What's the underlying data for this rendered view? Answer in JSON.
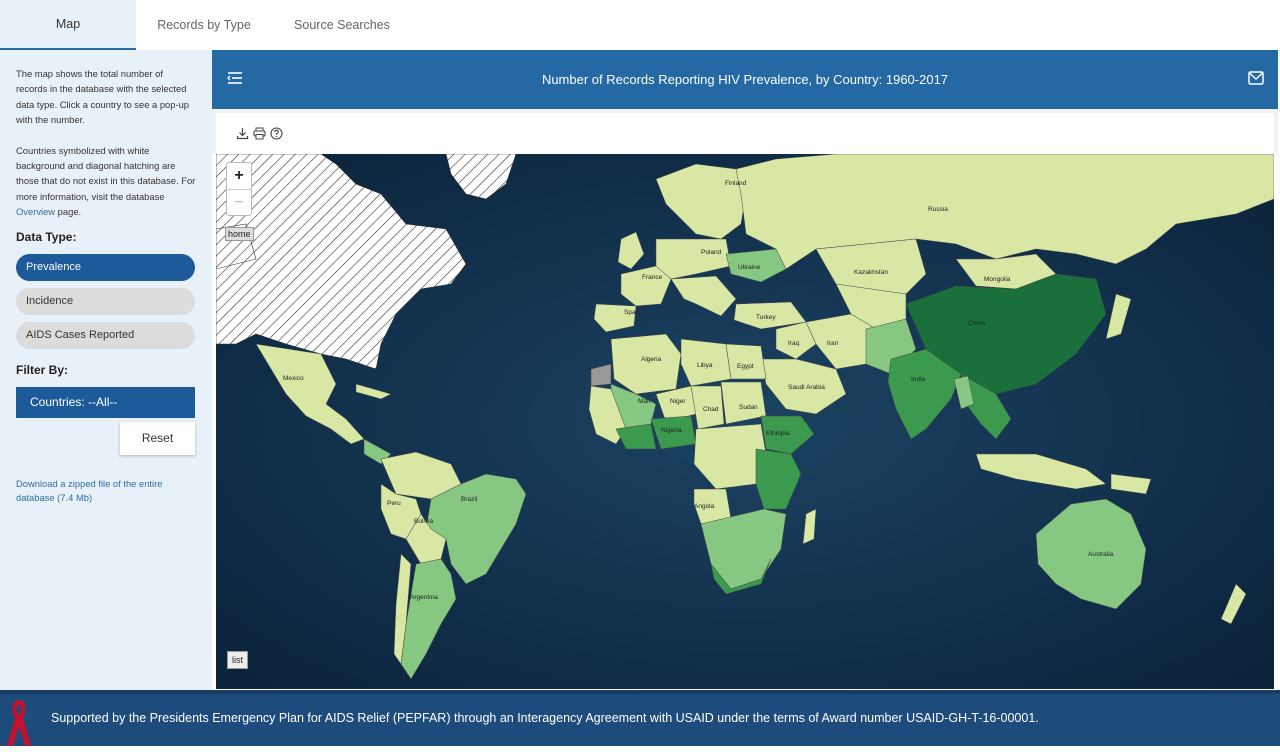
{
  "tabs": [
    {
      "label": "Map",
      "active": true
    },
    {
      "label": "Records by Type",
      "active": false
    },
    {
      "label": "Source Searches",
      "active": false
    }
  ],
  "sidebar": {
    "description_1": "The map shows the total number of records in the database with the selected data type. Click a country to see a pop-up with the number.",
    "description_2_prefix": "Countries symbolized with white background and diagonal hatching are those that do not exist in this database. For more information, visit the database ",
    "description_2_link": "Overview",
    "description_2_suffix": " page.",
    "data_type_title": "Data Type:",
    "data_types": [
      {
        "label": "Prevalence",
        "selected": true
      },
      {
        "label": "Incidence",
        "selected": false
      },
      {
        "label": "AIDS Cases Reported",
        "selected": false
      }
    ],
    "filter_title": "Filter By:",
    "filter_countries": "Countries: --All--",
    "reset_label": "Reset",
    "download_link": "Download a zipped file of the entire database (7.4 Mb)"
  },
  "header": {
    "title": "Number of Records Reporting HIV Prevalence, by Country: 1960-2017"
  },
  "map": {
    "zoom_in": "+",
    "zoom_out": "−",
    "home_label": "home",
    "list_label": "list",
    "countries": {
      "finland": "Finland",
      "russia": "Russia",
      "poland": "Poland",
      "ukraine": "Ukraine",
      "kazakhstan": "Kazakhstan",
      "mongolia": "Mongolia",
      "france": "France",
      "spain": "Spain",
      "turkey": "Turkey",
      "china": "China",
      "iraq": "Iraq",
      "iran": "Iran",
      "algeria": "Algeria",
      "libya": "Libya",
      "egypt": "Egypt",
      "mexico": "Mexico",
      "saudi_arabia": "Saudi Arabia",
      "india": "India",
      "mali": "Mali",
      "niger": "Niger",
      "chad": "Chad",
      "sudan": "Sudan",
      "nigeria": "Nigeria",
      "ethiopia": "Ethiopia",
      "brazil": "Brazil",
      "peru": "Peru",
      "bolivia": "Bolivia",
      "angola": "Angola",
      "australia": "Australia",
      "argentina": "Argentina"
    },
    "colors": {
      "ocean": "#0f2b45",
      "not_in_db": "#ffffff",
      "low": "#d9e7a4",
      "mid": "#86c882",
      "high": "#3c9a4e",
      "highest": "#19703a"
    }
  },
  "footer": {
    "text": "Supported by the Presidents Emergency Plan for AIDS Relief (PEPFAR) through an Interagency Agreement with USAID under the terms of Award number USAID-GH-T-16-00001."
  }
}
